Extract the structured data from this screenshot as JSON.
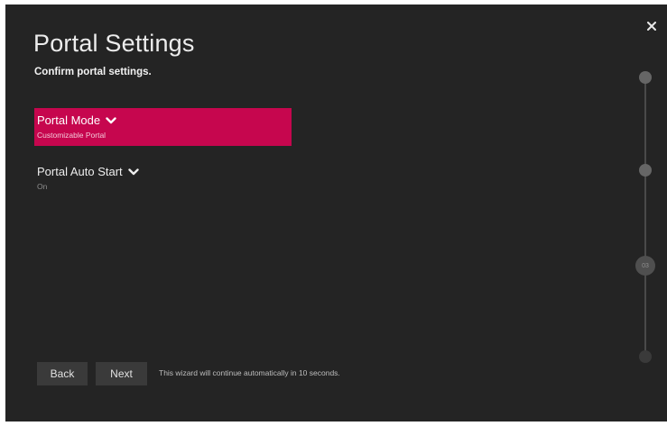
{
  "header": {
    "title": "Portal Settings",
    "subtitle": "Confirm portal settings.",
    "close_icon": "close-icon"
  },
  "settings": [
    {
      "label": "Portal Mode",
      "value": "Customizable Portal",
      "focused": true,
      "icon": "chevron-down-icon"
    },
    {
      "label": "Portal Auto Start",
      "value": "On",
      "focused": false,
      "icon": "chevron-down-icon"
    }
  ],
  "footer": {
    "back_label": "Back",
    "next_label": "Next",
    "auto_continue_text": "This wizard will continue automatically in 10 seconds."
  },
  "stepper": {
    "current_step_label": "03",
    "steps_total": 4,
    "current_index": 3
  },
  "colors": {
    "background": "#242424",
    "accent": "#c6064e",
    "button": "#3a3a3a"
  }
}
